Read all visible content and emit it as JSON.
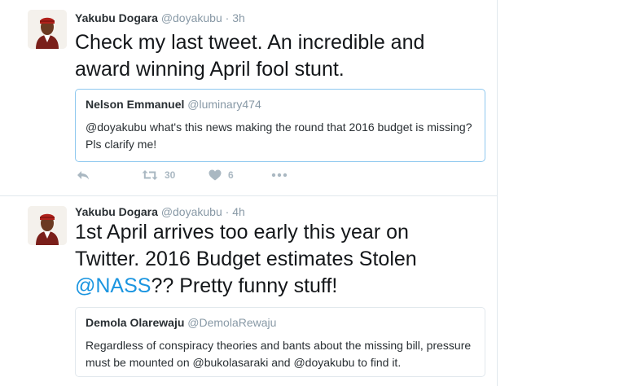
{
  "tweets": [
    {
      "author_name": "Yakubu Dogara",
      "author_handle": "@doyakubu",
      "separator": "·",
      "time": "3h",
      "text": "Check my last tweet. An incredible and award winning April fool stunt.",
      "quoted": {
        "author_name": "Nelson Emmanuel",
        "author_handle": "@luminary474",
        "text": "@doyakubu what's this news making the round that 2016 budget is missing? Pls clarify me!"
      },
      "actions": {
        "reply_icon": "reply-icon",
        "retweet_icon": "retweet-icon",
        "retweet_count": "30",
        "like_icon": "heart-icon",
        "like_count": "6",
        "more_icon": "more-icon"
      }
    },
    {
      "author_name": "Yakubu Dogara",
      "author_handle": "@doyakubu",
      "separator": "·",
      "time": "4h",
      "text_before": "1st April arrives too early this year on Twitter. 2016 Budget estimates Stolen ",
      "text_mention": "@NASS",
      "text_after": "??  Pretty funny stuff!",
      "quoted": {
        "author_name": "Demola Olarewaju",
        "author_handle": "@DemolaRewaju",
        "text": "Regardless of conspiracy theories and bants about the missing bill, pressure must be mounted on @bukolasaraki and @doyakubu to find it."
      }
    }
  ],
  "colors": {
    "link": "#1b95e0",
    "muted": "#8899a6",
    "quote_border_active": "#8ec8ef",
    "divider": "#e1e8ed"
  }
}
